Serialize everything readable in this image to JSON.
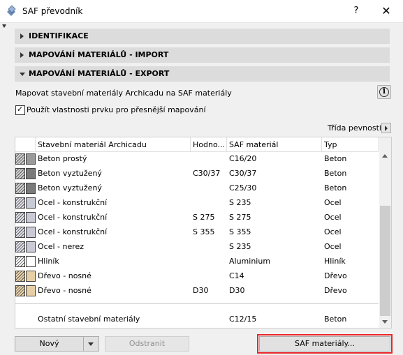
{
  "window": {
    "title": "SAF převodník",
    "help": "?",
    "close": "✕"
  },
  "sections": [
    {
      "label": "IDENTIFIKACE",
      "expanded": false
    },
    {
      "label": "MAPOVÁNÍ MATERIÁLŮ - IMPORT",
      "expanded": false
    },
    {
      "label": "MAPOVÁNÍ MATERIÁLŮ - EXPORT",
      "expanded": true
    }
  ],
  "export": {
    "description": "Mapovat stavební materiály Archicadu na SAF materiály",
    "info_icon": "i",
    "checkbox_label": "Použít vlastnosti prvku pro přesnější mapování",
    "checkbox_checked": true,
    "sort_label": "Třída pevnosti"
  },
  "table": {
    "columns": [
      "Stavební materiál Archicadu",
      "Hodno...",
      "SAF materiál",
      "Typ"
    ],
    "rows": [
      {
        "swatch": "concrete-light",
        "material": "Beton prostý",
        "value": "",
        "saf": "C16/20",
        "type": "Beton"
      },
      {
        "swatch": "concrete",
        "material": "Beton vyztužený",
        "value": "C30/37",
        "saf": "C30/37",
        "type": "Beton"
      },
      {
        "swatch": "concrete",
        "material": "Beton vyztužený",
        "value": "",
        "saf": "C25/30",
        "type": "Beton"
      },
      {
        "swatch": "steel",
        "material": "Ocel - konstrukční",
        "value": "",
        "saf": "S 235",
        "type": "Ocel"
      },
      {
        "swatch": "steel",
        "material": "Ocel - konstrukční",
        "value": "S 275",
        "saf": "S 275",
        "type": "Ocel"
      },
      {
        "swatch": "steel",
        "material": "Ocel - konstrukční",
        "value": "S 355",
        "saf": "S 355",
        "type": "Ocel"
      },
      {
        "swatch": "steel",
        "material": "Ocel - nerez",
        "value": "",
        "saf": "S 235",
        "type": "Ocel"
      },
      {
        "swatch": "aluminium",
        "material": "Hliník",
        "value": "",
        "saf": "Aluminium",
        "type": "Hliník"
      },
      {
        "swatch": "wood",
        "material": "Dřevo - nosné",
        "value": "",
        "saf": "C14",
        "type": "Dřevo"
      },
      {
        "swatch": "wood",
        "material": "Dřevo - nosné",
        "value": "D30",
        "saf": "D30",
        "type": "Dřevo"
      }
    ],
    "other": {
      "material": "Ostatní stavební materiály",
      "saf": "C12/15",
      "type": "Beton"
    }
  },
  "buttons": {
    "new": "Nový",
    "remove": "Odstranit",
    "saf_materials": "SAF materiály..."
  },
  "colors": {
    "highlight": "#e8262a",
    "section_bg": "#dcdcdc"
  }
}
